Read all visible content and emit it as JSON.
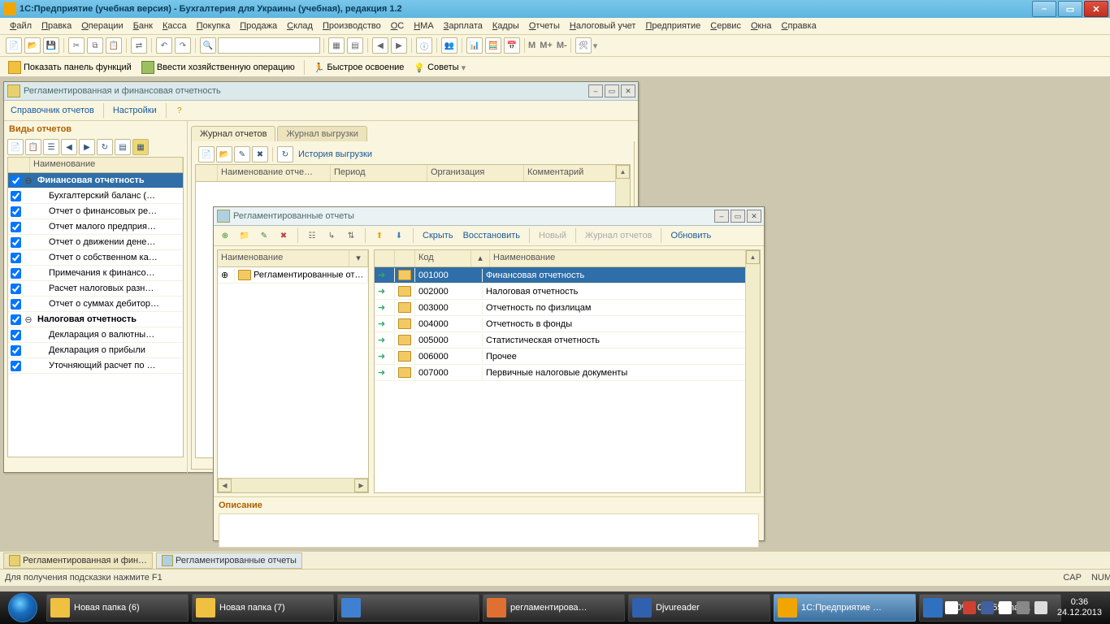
{
  "app_title": "1С:Предприятие (учебная версия) - Бухгалтерия для Украины (учебная), редакция 1.2",
  "menu": [
    "Файл",
    "Правка",
    "Операции",
    "Банк",
    "Касса",
    "Покупка",
    "Продажа",
    "Склад",
    "Производство",
    "ОС",
    "НМА",
    "Зарплата",
    "Кадры",
    "Отчеты",
    "Налоговый учет",
    "Предприятие",
    "Сервис",
    "Окна",
    "Справка"
  ],
  "tb_m": "М",
  "tb_mp": "М+",
  "tb_mm": "М-",
  "sub_tb": {
    "show_panel": "Показать панель функций",
    "enter_op": "Ввести хозяйственную операцию",
    "quick": "Быстрое освоение",
    "tips": "Советы"
  },
  "win1": {
    "title": "Регламентированная и финансовая отчетность",
    "tb": [
      "Справочник отчетов",
      "Настройки"
    ],
    "section": "Виды отчетов",
    "name_col": "Наименование",
    "items": [
      {
        "txt": "Финансовая  отчетность",
        "bold": true,
        "sel": true,
        "exp": "⊖"
      },
      {
        "txt": "Бухгалтерский баланс (…",
        "bold": false,
        "indent": true
      },
      {
        "txt": "Отчет о финансовых ре…",
        "bold": false,
        "indent": true
      },
      {
        "txt": "Отчет малого предприя…",
        "bold": false,
        "indent": true
      },
      {
        "txt": "Отчет о движении дене…",
        "bold": false,
        "indent": true
      },
      {
        "txt": "Отчет о собственном ка…",
        "bold": false,
        "indent": true
      },
      {
        "txt": "Примечания к финансо…",
        "bold": false,
        "indent": true
      },
      {
        "txt": "Расчет налоговых разн…",
        "bold": false,
        "indent": true
      },
      {
        "txt": "Отчет о суммах дебитор…",
        "bold": false,
        "indent": true
      },
      {
        "txt": "Налоговая отчетность",
        "bold": true,
        "exp": "⊖"
      },
      {
        "txt": "Декларация о валютны…",
        "bold": false,
        "indent": true
      },
      {
        "txt": "Декларация о прибыли",
        "bold": false,
        "indent": true
      },
      {
        "txt": "Уточняющий расчет по …",
        "bold": false,
        "indent": true
      }
    ],
    "tabs": [
      "Журнал отчетов",
      "Журнал выгрузки"
    ],
    "history": "История выгрузки",
    "cols": [
      "Наименование отче…",
      "Период",
      "Организация",
      "Комментарий"
    ]
  },
  "win2": {
    "title": "Регламентированные отчеты",
    "tb": {
      "hide": "Скрыть",
      "restore": "Восстановить",
      "new": "Новый",
      "journal": "Журнал отчетов",
      "refresh": "Обновить"
    },
    "left_col": "Наименование",
    "tree_item": "Регламентированные от…",
    "right_cols": {
      "code": "Код",
      "name": "Наименование"
    },
    "rows": [
      {
        "code": "001000",
        "name": "Финансовая  отчетность",
        "sel": true
      },
      {
        "code": "002000",
        "name": "Налоговая отчетность"
      },
      {
        "code": "003000",
        "name": "Отчетность по физлицам"
      },
      {
        "code": "004000",
        "name": "Отчетность в фонды"
      },
      {
        "code": "005000",
        "name": "Статистическая отчетность"
      },
      {
        "code": "006000",
        "name": "Прочее"
      },
      {
        "code": "007000",
        "name": "Первичные налоговые документы"
      }
    ],
    "desc": "Описание"
  },
  "window_tabs": [
    "Регламентированная и фин…",
    "Регламентированные отчеты"
  ],
  "status": "Для получения подсказки нажмите F1",
  "status_right": [
    "CAP",
    "NUM"
  ],
  "taskbar": {
    "btns": [
      "Новая папка (6)",
      "Новая папка (7)",
      "",
      "регламентирова…",
      "Djvureader",
      "1С:Предприятие …",
      "090% - 04855 char…"
    ],
    "time": "0:36",
    "date": "24.12.2013"
  }
}
